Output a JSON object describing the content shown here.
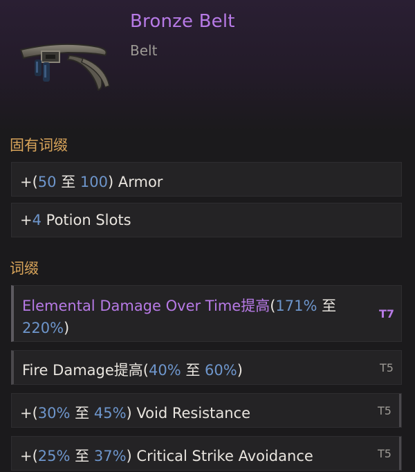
{
  "item": {
    "name": "Bronze Belt",
    "type": "Belt",
    "image": "belt-icon"
  },
  "implicits": {
    "title": "固有词缀",
    "rows": [
      {
        "prefix": "+(",
        "min": "50",
        "sep": " 至 ",
        "max": "100",
        "suffix": ") Armor"
      },
      {
        "prefix": "+",
        "value": "4",
        "suffix": " Potion Slots"
      }
    ]
  },
  "affixes": {
    "title": "词缀",
    "rows": [
      {
        "name": "Elemental Damage Over Time提高",
        "open": "(",
        "min": "171%",
        "sep": " 至",
        "max": "220%",
        "close": ")",
        "tier": "T7"
      },
      {
        "name": "Fire Damage提高",
        "open": "(",
        "min": "40%",
        "sep": " 至 ",
        "max": "60%",
        "close": ")",
        "tier": "T5"
      },
      {
        "prefix": "+(",
        "min": "30%",
        "sep": " 至 ",
        "max": "45%",
        "suffix": ") Void Resistance",
        "tier": "T5"
      },
      {
        "prefix": "+(",
        "min": "25%",
        "sep": " 至 ",
        "max": "37%",
        "suffix": ") Critical Strike Avoidance",
        "tier": "T5"
      }
    ]
  },
  "colors": {
    "name": "#b77ae6",
    "section": "#d8a45a",
    "number": "#6e96cc",
    "text": "#e9e5df",
    "muted": "#9d9a95"
  }
}
